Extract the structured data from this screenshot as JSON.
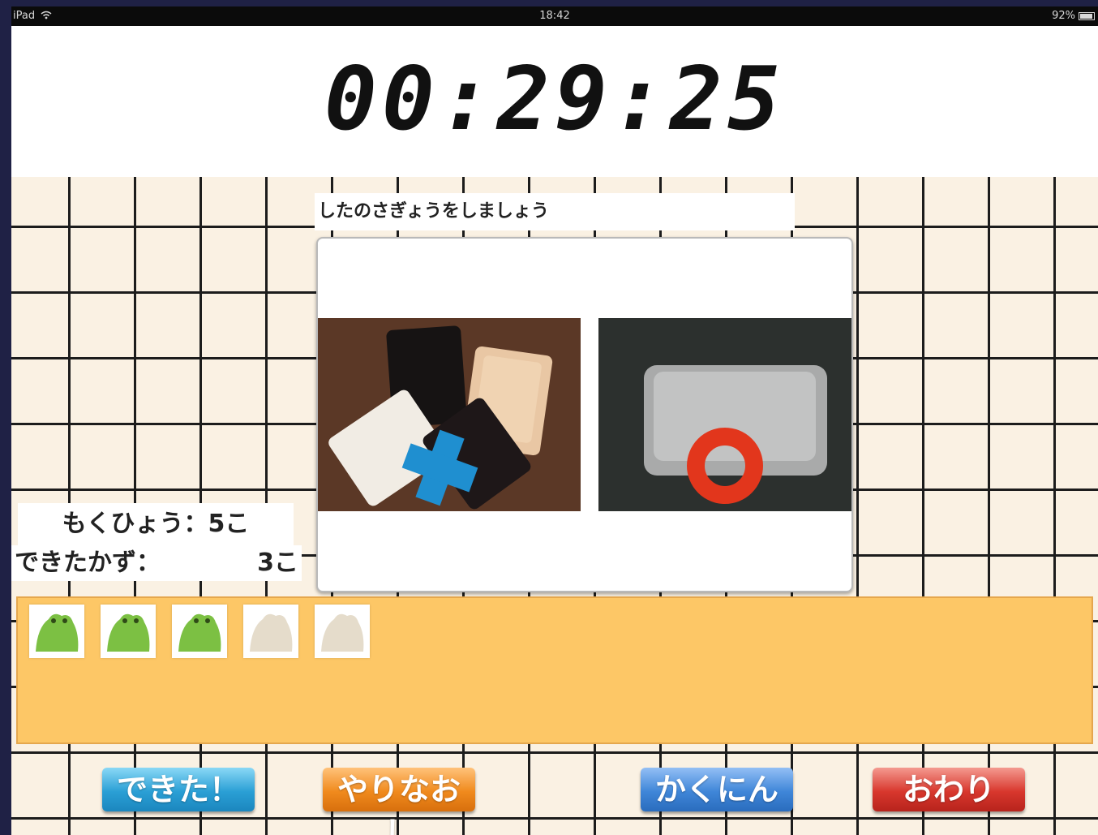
{
  "status_bar": {
    "device": "iPad",
    "wifi_icon": "wifi-icon",
    "time": "18:42",
    "battery": "92%"
  },
  "timer": {
    "display": "00:29:25"
  },
  "instruction": {
    "text": "したのさぎょうをしましょう"
  },
  "task_card": {
    "wrong_photo": {
      "description_icon": "cross-mark-icon",
      "color": "#1f8fd0"
    },
    "right_photo": {
      "description_icon": "circle-mark-icon",
      "color": "#e2361c"
    }
  },
  "counter": {
    "target_label": "もくひょう：5こ",
    "done_label": "できたかず：",
    "done_value": "3こ"
  },
  "tray": {
    "tokens": [
      {
        "state": "done",
        "color": "#7cc043"
      },
      {
        "state": "done",
        "color": "#7cc043"
      },
      {
        "state": "done",
        "color": "#7cc043"
      },
      {
        "state": "pending",
        "color": "#e5dccb"
      },
      {
        "state": "pending",
        "color": "#e5dccb"
      }
    ]
  },
  "buttons": {
    "done": "できた！",
    "redo": "やりなおし",
    "check": "かくにん",
    "end": "おわり"
  }
}
